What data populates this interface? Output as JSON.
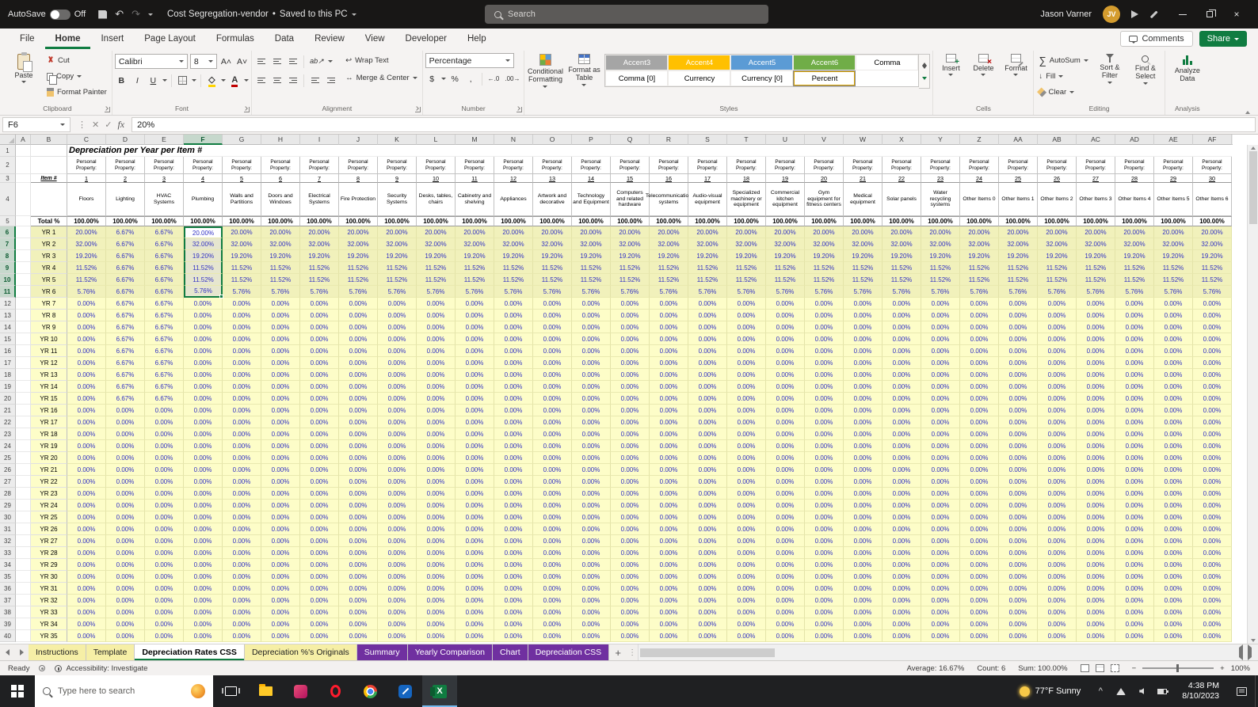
{
  "titlebar": {
    "autosave_label": "AutoSave",
    "autosave_state": "Off",
    "doc_title": "Cost Segregation-vendor",
    "doc_separator": "•",
    "doc_status": "Saved to this PC",
    "search_placeholder": "Search",
    "user_name": "Jason Varner",
    "user_initials": "JV"
  },
  "ribbon_tabs": {
    "items": [
      "File",
      "Home",
      "Insert",
      "Page Layout",
      "Formulas",
      "Data",
      "Review",
      "View",
      "Developer",
      "Help"
    ],
    "active": "Home",
    "comments_label": "Comments",
    "share_label": "Share"
  },
  "ribbon": {
    "clipboard": {
      "group_label": "Clipboard",
      "paste": "Paste",
      "cut": "Cut",
      "copy": "Copy",
      "format_painter": "Format Painter"
    },
    "font": {
      "group_label": "Font",
      "family": "Calibri",
      "size": "8"
    },
    "alignment": {
      "group_label": "Alignment",
      "wrap_text": "Wrap Text",
      "merge_center": "Merge & Center"
    },
    "number": {
      "group_label": "Number",
      "format": "Percentage"
    },
    "styles": {
      "group_label": "Styles",
      "conditional_l1": "Conditional",
      "conditional_l2": "Formatting",
      "format_table_l1": "Format as",
      "format_table_l2": "Table",
      "gallery": [
        {
          "label": "Accent3",
          "bg": "#A5A5A5",
          "fg": "#FFFFFF",
          "selected": false
        },
        {
          "label": "Accent4",
          "bg": "#FFC000",
          "fg": "#FFFFFF",
          "selected": false
        },
        {
          "label": "Accent5",
          "bg": "#5B9BD5",
          "fg": "#FFFFFF",
          "selected": false
        },
        {
          "label": "Accent6",
          "bg": "#70AD47",
          "fg": "#FFFFFF",
          "selected": false
        },
        {
          "label": "Comma",
          "bg": "#FFFFFF",
          "fg": "#000000",
          "selected": false
        },
        {
          "label": "Comma [0]",
          "bg": "#FFFFFF",
          "fg": "#000000",
          "selected": false
        },
        {
          "label": "Currency",
          "bg": "#FFFFFF",
          "fg": "#000000",
          "selected": false
        },
        {
          "label": "Currency [0]",
          "bg": "#FFFFFF",
          "fg": "#000000",
          "selected": false
        },
        {
          "label": "Percent",
          "bg": "#FFFFFF",
          "fg": "#000000",
          "selected": true
        }
      ]
    },
    "cells": {
      "group_label": "Cells",
      "insert": "Insert",
      "delete": "Delete",
      "format": "Format"
    },
    "editing": {
      "group_label": "Editing",
      "autosum": "AutoSum",
      "fill": "Fill",
      "clear": "Clear",
      "sort_l1": "Sort &",
      "sort_l2": "Filter",
      "find_l1": "Find &",
      "find_l2": "Select"
    },
    "analysis": {
      "group_label": "Analysis",
      "analyze_l1": "Analyze",
      "analyze_l2": "Data"
    }
  },
  "formula_bar": {
    "name_box": "F6",
    "value": "20%"
  },
  "grid": {
    "title": "Depreciation per Year per Item #",
    "col_letters": [
      "A",
      "B",
      "C",
      "D",
      "E",
      "F",
      "G",
      "H",
      "I",
      "J",
      "K",
      "L",
      "M",
      "N",
      "O",
      "P",
      "Q",
      "R",
      "S",
      "T",
      "U",
      "V",
      "W",
      "X",
      "Y",
      "Z",
      "AA",
      "AB",
      "AC",
      "AD",
      "AE",
      "AF"
    ],
    "selected_col": "F",
    "selected_rows_start": 6,
    "selected_rows_end": 11,
    "property_label": "Personal Property:",
    "item_label": "Item #",
    "item_numbers": [
      "1",
      "2",
      "3",
      "4",
      "5",
      "6",
      "7",
      "8",
      "9",
      "10",
      "11",
      "12",
      "13",
      "14",
      "15",
      "16",
      "17",
      "18",
      "19",
      "20",
      "21",
      "22",
      "23",
      "24",
      "25",
      "26",
      "27",
      "28",
      "29",
      "30"
    ],
    "categories": [
      "Floors",
      "Lighting",
      "HVAC Systems",
      "Plumbing",
      "Walls and Partitions",
      "Doors and Windows",
      "Electrical Systems",
      "Fire Protection",
      "Security Systems",
      "Desks, tables, chairs",
      "Cabinetry and shelving",
      "Appliances",
      "Artwork and decorative",
      "Technology and Equipment",
      "Computers and related hardware",
      "Telecommunication systems",
      "Audio-visual equipment",
      "Specialized machinery or equipment",
      "Commercial kitchen equipment",
      "Gym equipment for fitness centers",
      "Medical equipment",
      "Solar panels",
      "Water recycling systems",
      "Other Items 0",
      "Other Items 1",
      "Other Items 2",
      "Other Items 3",
      "Other Items 4",
      "Other Items 5",
      "Other Items 6"
    ],
    "total_label": "Total %",
    "total_value": "100.00%",
    "year_labels": [
      "YR 1",
      "YR 2",
      "YR 3",
      "YR 4",
      "YR 5",
      "YR 6",
      "YR 7",
      "YR 8",
      "YR 9",
      "YR 10",
      "YR 11",
      "YR 12",
      "YR 13",
      "YR 14",
      "YR 15",
      "YR 16",
      "YR 17",
      "YR 18",
      "YR 19",
      "YR 20",
      "YR 21",
      "YR 22",
      "YR 23",
      "YR 24",
      "YR 25",
      "YR 26",
      "YR 27",
      "YR 28",
      "YR 29",
      "YR 30",
      "YR 31",
      "YR 32",
      "YR 33",
      "YR 34",
      "YR 35"
    ],
    "macrs5": [
      "20.00%",
      "32.00%",
      "19.20%",
      "11.52%",
      "11.52%",
      "5.76%",
      "0.00%",
      "0.00%",
      "0.00%",
      "0.00%",
      "0.00%",
      "0.00%",
      "0.00%",
      "0.00%",
      "0.00%",
      "0.00%",
      "0.00%",
      "0.00%",
      "0.00%",
      "0.00%",
      "0.00%",
      "0.00%",
      "0.00%",
      "0.00%",
      "0.00%",
      "0.00%",
      "0.00%",
      "0.00%",
      "0.00%",
      "0.00%",
      "0.00%",
      "0.00%",
      "0.00%",
      "0.00%",
      "0.00%"
    ],
    "sl15": [
      "6.67%",
      "6.67%",
      "6.67%",
      "6.67%",
      "6.67%",
      "6.67%",
      "6.67%",
      "6.67%",
      "6.67%",
      "6.67%",
      "6.67%",
      "6.67%",
      "6.67%",
      "6.67%",
      "6.67%",
      "0.00%",
      "0.00%",
      "0.00%",
      "0.00%",
      "0.00%",
      "0.00%",
      "0.00%",
      "0.00%",
      "0.00%",
      "0.00%",
      "0.00%",
      "0.00%",
      "0.00%",
      "0.00%",
      "0.00%",
      "0.00%",
      "0.00%",
      "0.00%",
      "0.00%",
      "0.00%"
    ],
    "sl15_columns": [
      "D",
      "E"
    ]
  },
  "sheet_tabs": {
    "tabs": [
      {
        "label": "Instructions",
        "style": "yellow"
      },
      {
        "label": "Template",
        "style": "yellow"
      },
      {
        "label": "Depreciation Rates CSS",
        "style": "active"
      },
      {
        "label": "Depreciation %'s Originals",
        "style": "yellow"
      },
      {
        "label": "Summary",
        "style": "purple"
      },
      {
        "label": "Yearly Comparison",
        "style": "purple"
      },
      {
        "label": "Chart",
        "style": "purple"
      },
      {
        "label": "Depreciation CSS",
        "style": "purple"
      }
    ],
    "add_label": "+"
  },
  "status_bar": {
    "mode": "Ready",
    "accessibility": "Accessibility: Investigate",
    "average": "Average: 16.67%",
    "count": "Count: 6",
    "sum": "Sum: 100.00%",
    "zoom": "100%"
  },
  "taskbar": {
    "search_placeholder": "Type here to search",
    "weather": "77°F Sunny",
    "time": "4:38 PM",
    "date": "8/10/2023"
  },
  "glyphs": {
    "undo": "↶",
    "redo": "↷",
    "close": "×",
    "bold": "B",
    "italic": "I",
    "underline": "U",
    "autosum_sigma": "∑",
    "dollar": "$",
    "percent_sign": "%",
    "comma": ",",
    "increase_decimal": "←.0",
    "decrease_decimal": ".00→",
    "wrap_return": "↩",
    "merge_arrows": "↔",
    "orientation": "ab↗",
    "fill_arrow": "↓",
    "fx": "fx",
    "check": "✓",
    "x_small": "✕",
    "grip": "⋮",
    "ellipsis": "…",
    "font_bigger": "A˄",
    "font_smaller": "A˅",
    "tray_chevron": "^"
  }
}
